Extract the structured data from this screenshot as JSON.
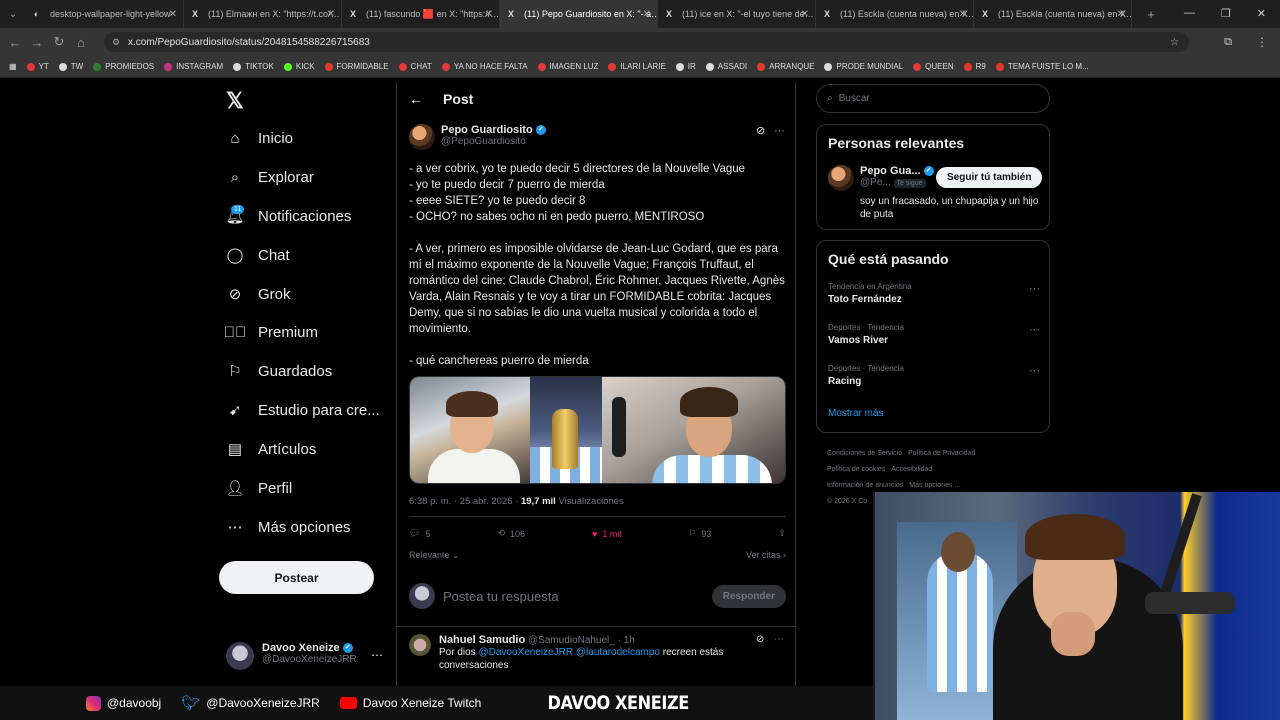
{
  "browser": {
    "tabs": [
      {
        "title": "desktop-wallpaper-light-yellow",
        "active": false
      },
      {
        "title": "(11) Elmaжн en X: \"https://t.co/…",
        "active": false
      },
      {
        "title": "(11) fascundo 🟥 en X: \"https://…",
        "active": false
      },
      {
        "title": "(11) Pepo Guardiosito en X: \"- a…",
        "active": true
      },
      {
        "title": "(11) ice en X: \"-el tuyo tiene de…",
        "active": false
      },
      {
        "title": "(11) Esckla (cuenta nueva) en X…",
        "active": false
      },
      {
        "title": "(11) Esckla (cuenta nueva) en X…",
        "active": false
      }
    ],
    "url": "x.com/PepoGuardiosito/status/2048154588226715683",
    "bookmarks": [
      "YT",
      "TW",
      "PROMIEDOS",
      "INSTAGRAM",
      "TIKTOK",
      "KICK",
      "FORMIDABLE",
      "CHAT",
      "YA NO HACE FALTA",
      "IMAGEN LUZ",
      "ILARI LARIE",
      "IR",
      "ASSADI",
      "ARRANQUE",
      "PRODE MUNDIAL",
      "QUEEN",
      "R9",
      "TEMA FUISTE LO M..."
    ]
  },
  "nav": {
    "items": [
      {
        "label": "Inicio",
        "icon": "home-icon"
      },
      {
        "label": "Explorar",
        "icon": "search-icon"
      },
      {
        "label": "Notificaciones",
        "icon": "bell-icon"
      },
      {
        "label": "Chat",
        "icon": "chat-icon"
      },
      {
        "label": "Grok",
        "icon": "grok-icon"
      },
      {
        "label": "Premium",
        "icon": "premium-icon"
      },
      {
        "label": "Guardados",
        "icon": "bookmark-icon"
      },
      {
        "label": "Estudio para cre...",
        "icon": "rocket-icon"
      },
      {
        "label": "Artículos",
        "icon": "article-icon"
      },
      {
        "label": "Perfil",
        "icon": "person-icon"
      },
      {
        "label": "Más opciones",
        "icon": "more-icon"
      }
    ],
    "notif_count": "11",
    "post_button": "Postear",
    "me": {
      "name": "Davoo Xeneize",
      "handle": "@DavooXeneizeJRR"
    }
  },
  "post": {
    "header": "Post",
    "author": {
      "name": "Pepo Guardiosito",
      "handle": "@PepoGuardiosito"
    },
    "lines": [
      "- a ver cobrix, yo te puedo decir 5 directores de la Nouvelle Vague",
      "- yo te puedo decir 7 puerro de mierda",
      "- eeee SIETE? yo te puedo decir 8",
      "- OCHO? no sabes ocho ni en pedo puerro, MENTIROSO",
      "",
      "- A ver, primero es imposible olvidarse de Jean-Luc Godard, que es para mí el máximo exponente de la Nouvelle Vague; François Truffaut, el romántico del cine; Claude Chabrol, Éric Rohmer, Jacques Rivette, Agnès Varda, Alain Resnais y te voy a tirar un FORMIDABLE cobrita: Jacques Demy, que si no sabías le dio una vuelta musical y colorida a todo el movimiento.",
      "",
      "- qué canchereas puerro de mierda"
    ],
    "time": "6:38 p. m. · 25 abr. 2026 · ",
    "views": "19,7 mil",
    "views_label": " Visualizaciones",
    "replies": "5",
    "reposts": "106",
    "likes": "1 mil",
    "bookmarks": "93",
    "sort_label": "Relevante",
    "quotes_link": "Ver citas",
    "reply_placeholder": "Postea tu respuesta",
    "reply_button": "Responder"
  },
  "comment": {
    "name": "Nahuel Samudio",
    "handle": "@SamudioNahuel_",
    "time": "· 1h",
    "text_prefix": "Por dios ",
    "mention1": "@DavooXeneizeJRR",
    "mention2": "@lautarodelcampo",
    "text_suffix": " recreen estás conversaciones"
  },
  "right": {
    "search_placeholder": "Buscar",
    "relevant_title": "Personas relevantes",
    "relevant_user": {
      "name": "Pepo Gua...",
      "handle": "@Pe...",
      "follows_you": "Te sigue",
      "bio": "soy un fracasado, un chupapija y un hijo de puta"
    },
    "follow_button": "Seguir tú también",
    "trends_title": "Qué está pasando",
    "trends": [
      {
        "category": "Tendencia en Argentina",
        "title": "Toto Fernández"
      },
      {
        "category": "Deportes · Tendencia",
        "title": "Vamos River"
      },
      {
        "category": "Deportes · Tendencia",
        "title": "Racing"
      }
    ],
    "show_more": "Mostrar más",
    "footer": [
      "Condiciones de Servicio",
      "Política de Privacidad",
      "Política de cookies",
      "Accesibilidad",
      "Información de anuncios",
      "Más opciones ...",
      "© 2026 X Co"
    ]
  },
  "overlay": {
    "instagram": "@davoobj",
    "twitter": "@DavooXeneizeJRR",
    "youtube": "Davoo Xeneize Twitch",
    "brand": "DAVOO XENEIZE"
  },
  "colors": {
    "accent": "#1d9bf0",
    "like": "#f91880",
    "bg": "#000000"
  }
}
